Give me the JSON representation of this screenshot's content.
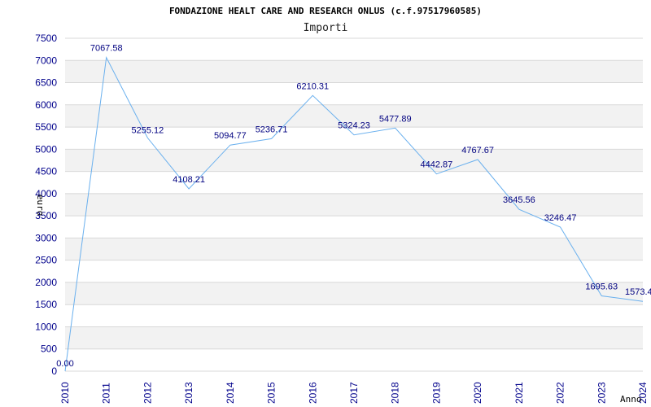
{
  "chart_data": {
    "type": "line",
    "title": "FONDAZIONE HEALT CARE AND RESEARCH ONLUS (c.f.97517960585)",
    "subtitle": "Importi",
    "ylabel": "euro",
    "xlabel": "Anno",
    "categories": [
      "2010",
      "2011",
      "2012",
      "2013",
      "2014",
      "2015",
      "2016",
      "2017",
      "2018",
      "2019",
      "2020",
      "2021",
      "2022",
      "2023",
      "2024"
    ],
    "values": [
      0.0,
      7067.58,
      5255.12,
      4108.21,
      5094.77,
      5236.71,
      6210.31,
      5324.23,
      5477.89,
      4442.87,
      4767.67,
      3645.56,
      3246.47,
      1695.63,
      1573.4
    ],
    "value_labels": [
      "0.00",
      "7067.58",
      "5255.12",
      "4108.21",
      "5094.77",
      "5236.71",
      "6210.31",
      "5324.23",
      "5477.89",
      "4442.87",
      "4767.67",
      "3645.56",
      "3246.47",
      "1695.63",
      "1573.4"
    ],
    "ylim": [
      0,
      7500
    ],
    "yticks": [
      0,
      500,
      1000,
      1500,
      2000,
      2500,
      3000,
      3500,
      4000,
      4500,
      5000,
      5500,
      6000,
      6500,
      7000,
      7500
    ],
    "grid": "horizontal",
    "colors": {
      "line": "#6ab0ee",
      "band": "#f2f2f2",
      "gridline": "#d8d8d8",
      "tick_text": "#00008b",
      "data_label": "#000080"
    }
  }
}
